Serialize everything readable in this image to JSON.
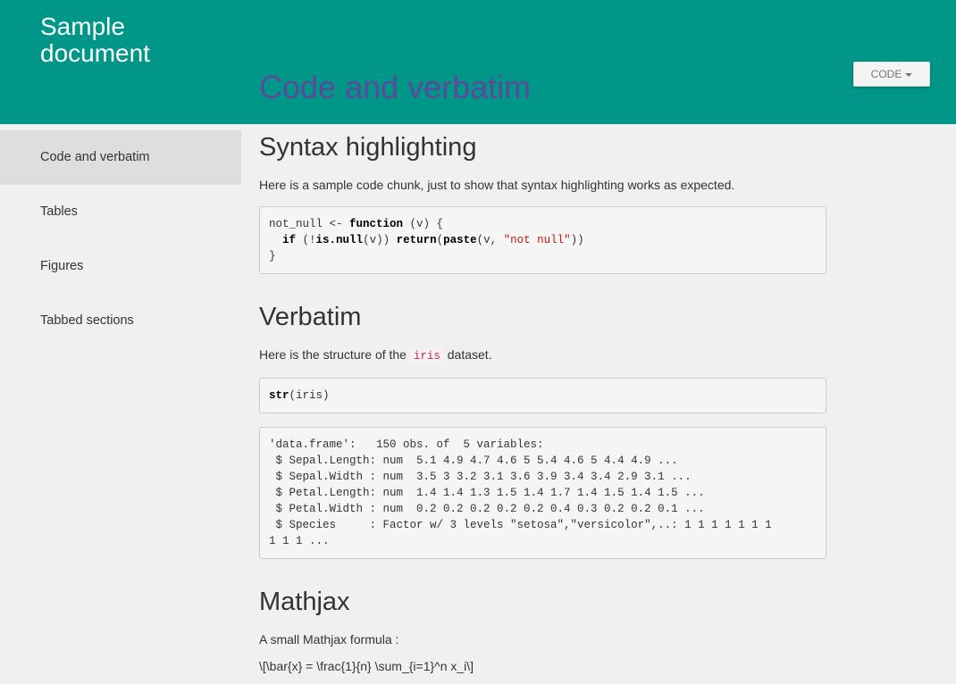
{
  "header": {
    "doc_title": "Sample document",
    "page_title": "Code and verbatim",
    "code_button_label": "CODE"
  },
  "sidebar": {
    "items": [
      {
        "label": "Code and verbatim",
        "active": true
      },
      {
        "label": "Tables",
        "active": false
      },
      {
        "label": "Figures",
        "active": false
      },
      {
        "label": "Tabbed sections",
        "active": false
      }
    ]
  },
  "main": {
    "syntax": {
      "title": "Syntax highlighting",
      "intro": "Here is a sample code chunk, just to show that syntax highlighting works as expected.",
      "code": {
        "line1_var": "not_null <- ",
        "line1_kw": "function",
        "line1_rest": " (v) {",
        "line2_indent": "  ",
        "line2_kw1": "if",
        "line2_mid1": " (!",
        "line2_kw2": "is.null",
        "line2_mid2": "(v)) ",
        "line2_kw3": "return",
        "line2_paren": "(",
        "line2_kw4": "paste",
        "line2_mid3": "(v, ",
        "line2_str": "\"not null\"",
        "line2_end": "))",
        "line3": "}"
      }
    },
    "verbatim": {
      "title": "Verbatim",
      "intro_before": "Here is the structure of the",
      "intro_code": "iris",
      "intro_after": "dataset.",
      "call_kw": "str",
      "call_rest": "(iris)",
      "output_lines": [
        "'data.frame':   150 obs. of  5 variables:",
        " $ Sepal.Length: num  5.1 4.9 4.7 4.6 5 5.4 4.6 5 4.4 4.9 ...",
        " $ Sepal.Width : num  3.5 3 3.2 3.1 3.6 3.9 3.4 3.4 2.9 3.1 ...",
        " $ Petal.Length: num  1.4 1.4 1.3 1.5 1.4 1.7 1.4 1.5 1.4 1.5 ...",
        " $ Petal.Width : num  0.2 0.2 0.2 0.2 0.2 0.4 0.3 0.2 0.2 0.1 ...",
        " $ Species     : Factor w/ 3 levels \"setosa\",\"versicolor\",..: 1 1 1 1 1 1 1",
        "1 1 1 ..."
      ]
    },
    "mathjax": {
      "title": "Mathjax",
      "intro": "A small Mathjax formula :",
      "formula": "\\[\\bar{x} = \\frac{1}{n} \\sum_{i=1}^n x_i\\]"
    }
  },
  "colors": {
    "header_bg": "#009688",
    "page_title": "#5b4a9b",
    "page_bg": "#f0f0f0",
    "sidebar_active_bg": "#dedede",
    "string": "#c41a16",
    "inline_code": "#c7254e"
  },
  "icons": {
    "code_button_caret": "caret-down-icon"
  }
}
